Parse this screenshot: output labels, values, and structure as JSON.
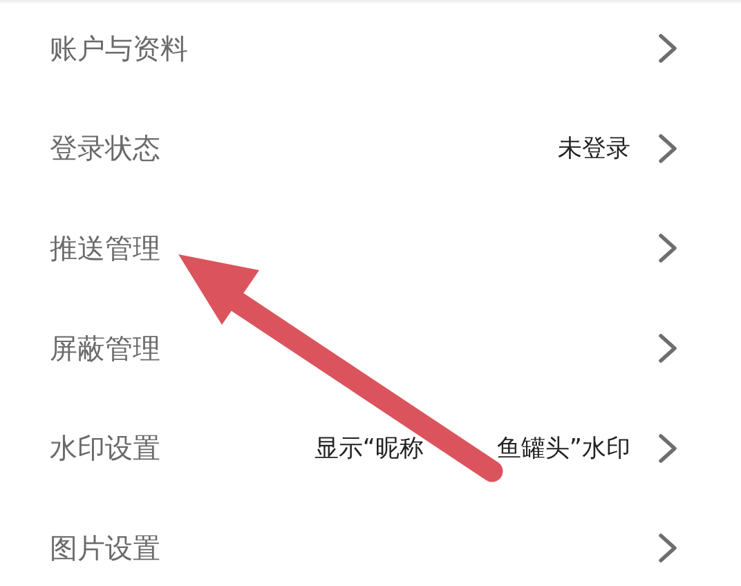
{
  "items": [
    {
      "label": "账户与资料"
    },
    {
      "label": "登录状态",
      "value_parts": [
        "未登录"
      ]
    },
    {
      "label": "推送管理"
    },
    {
      "label": "屏蔽管理"
    },
    {
      "label": "水印设置",
      "value_parts": [
        "显示“昵称",
        "鱼罐头”水印"
      ]
    },
    {
      "label": "图片设置"
    }
  ]
}
